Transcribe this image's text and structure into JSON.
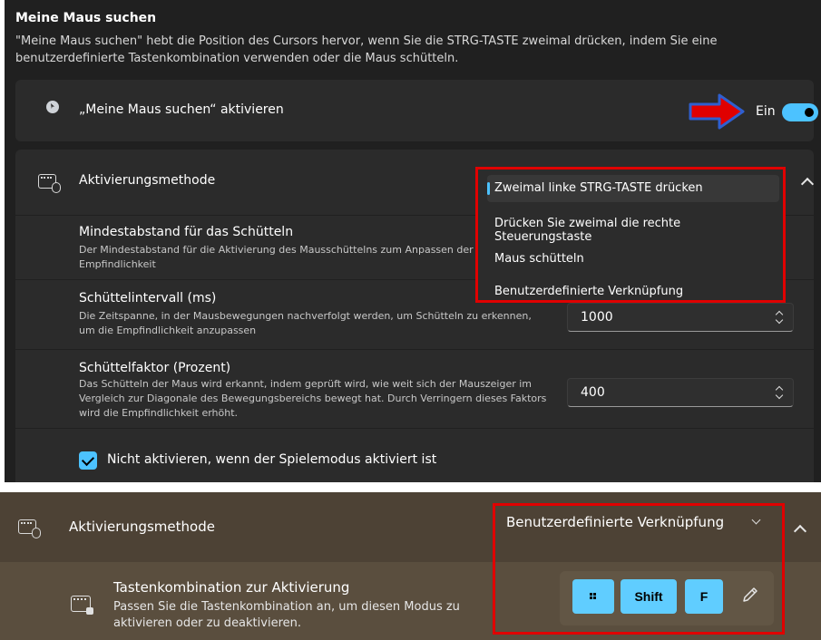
{
  "panel1": {
    "title": "Meine Maus suchen",
    "description": "\"Meine Maus suchen\" hebt die Position des Cursors hervor, wenn Sie die STRG-TASTE zweimal drücken, indem Sie eine benutzerdefinierte Tastenkombination verwenden oder die Maus schütteln.",
    "activate": {
      "label": "„Meine Maus suchen“ aktivieren",
      "toggle_label": "Ein",
      "toggle_on": true,
      "icon": "cursor-icon"
    },
    "method": {
      "label": "Aktivierungsmethode",
      "icon": "keyboard-mouse-icon",
      "dropdown_options": [
        "Zweimal linke STRG-TASTE drücken",
        "Drücken Sie zweimal die rechte Steuerungstaste",
        "Maus schütteln",
        "Benutzerdefinierte Verknüpfung"
      ],
      "selected_index": 0
    },
    "shake_distance": {
      "title": "Mindestabstand für das Schütteln",
      "description": "Der Mindestabstand für die Aktivierung des Mausschüttelns zum Anpassen der Empfindlichkeit"
    },
    "shake_interval": {
      "title": "Schüttelintervall (ms)",
      "description": "Die Zeitspanne, in der Mausbewegungen nachverfolgt werden, um Schütteln zu erkennen, um die Empfindlichkeit anzupassen",
      "value": "1000"
    },
    "shake_factor": {
      "title": "Schüttelfaktor (Prozent)",
      "description": "Das Schütteln der Maus wird erkannt, indem geprüft wird, wie weit sich der Mauszeiger im Vergleich zur Diagonale des Bewegungsbereichs bewegt hat. Durch Verringern dieses Faktors wird die Empfindlichkeit erhöht.",
      "value": "400"
    },
    "game_mode": {
      "label": "Nicht aktivieren, wenn der Spielemodus aktiviert ist",
      "checked": true
    }
  },
  "panel2": {
    "method_label": "Aktivierungsmethode",
    "selected_method": "Benutzerdefinierte Verknüpfung",
    "shortcut": {
      "title": "Tastenkombination zur Aktivierung",
      "description": "Passen Sie die Tastenkombination an, um diesen Modus zu aktivieren oder zu deaktivieren.",
      "keys": [
        "Windows",
        "Shift",
        "F"
      ],
      "key_labels": {
        "shift": "Shift",
        "f": "F"
      }
    }
  },
  "colors": {
    "accent": "#4cc2ff",
    "highlight_box": "#e00000",
    "arrow_fill": "#e00000",
    "arrow_outline": "#2f5fd0",
    "panel2_background": "#4d4235"
  }
}
